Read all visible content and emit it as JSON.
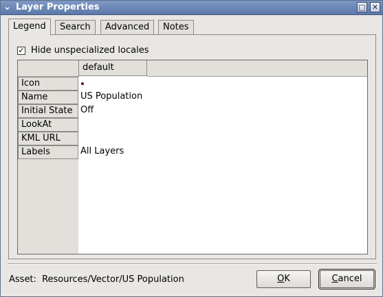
{
  "window": {
    "title": "Layer Properties",
    "menu_glyph": "⌄",
    "maximize_glyph": "□",
    "close_glyph": "✕"
  },
  "tabs": [
    {
      "label": "Legend",
      "active": true
    },
    {
      "label": "Search",
      "active": false
    },
    {
      "label": "Advanced",
      "active": false
    },
    {
      "label": "Notes",
      "active": false
    }
  ],
  "legend": {
    "hide_unspecialized": {
      "label": "Hide unspecialized locales",
      "checked": true,
      "check_glyph": "✓"
    },
    "column_header": "default",
    "rows": [
      {
        "label": "Icon",
        "value": "",
        "icon": "red-dot-icon",
        "icon_color": "#6a0000"
      },
      {
        "label": "Name",
        "value": "US Population"
      },
      {
        "label": "Initial State",
        "value": "Off"
      },
      {
        "label": "LookAt",
        "value": ""
      },
      {
        "label": "KML URL",
        "value": ""
      },
      {
        "label": "Labels",
        "value": "All Layers"
      }
    ]
  },
  "footer": {
    "asset_label": "Asset:",
    "asset_value": "Resources/Vector/US Population",
    "ok_label": "OK",
    "ok_mnemonic": "O",
    "ok_rest": "K",
    "cancel_label": "Cancel",
    "cancel_mnemonic": "C",
    "cancel_rest": "ancel"
  }
}
